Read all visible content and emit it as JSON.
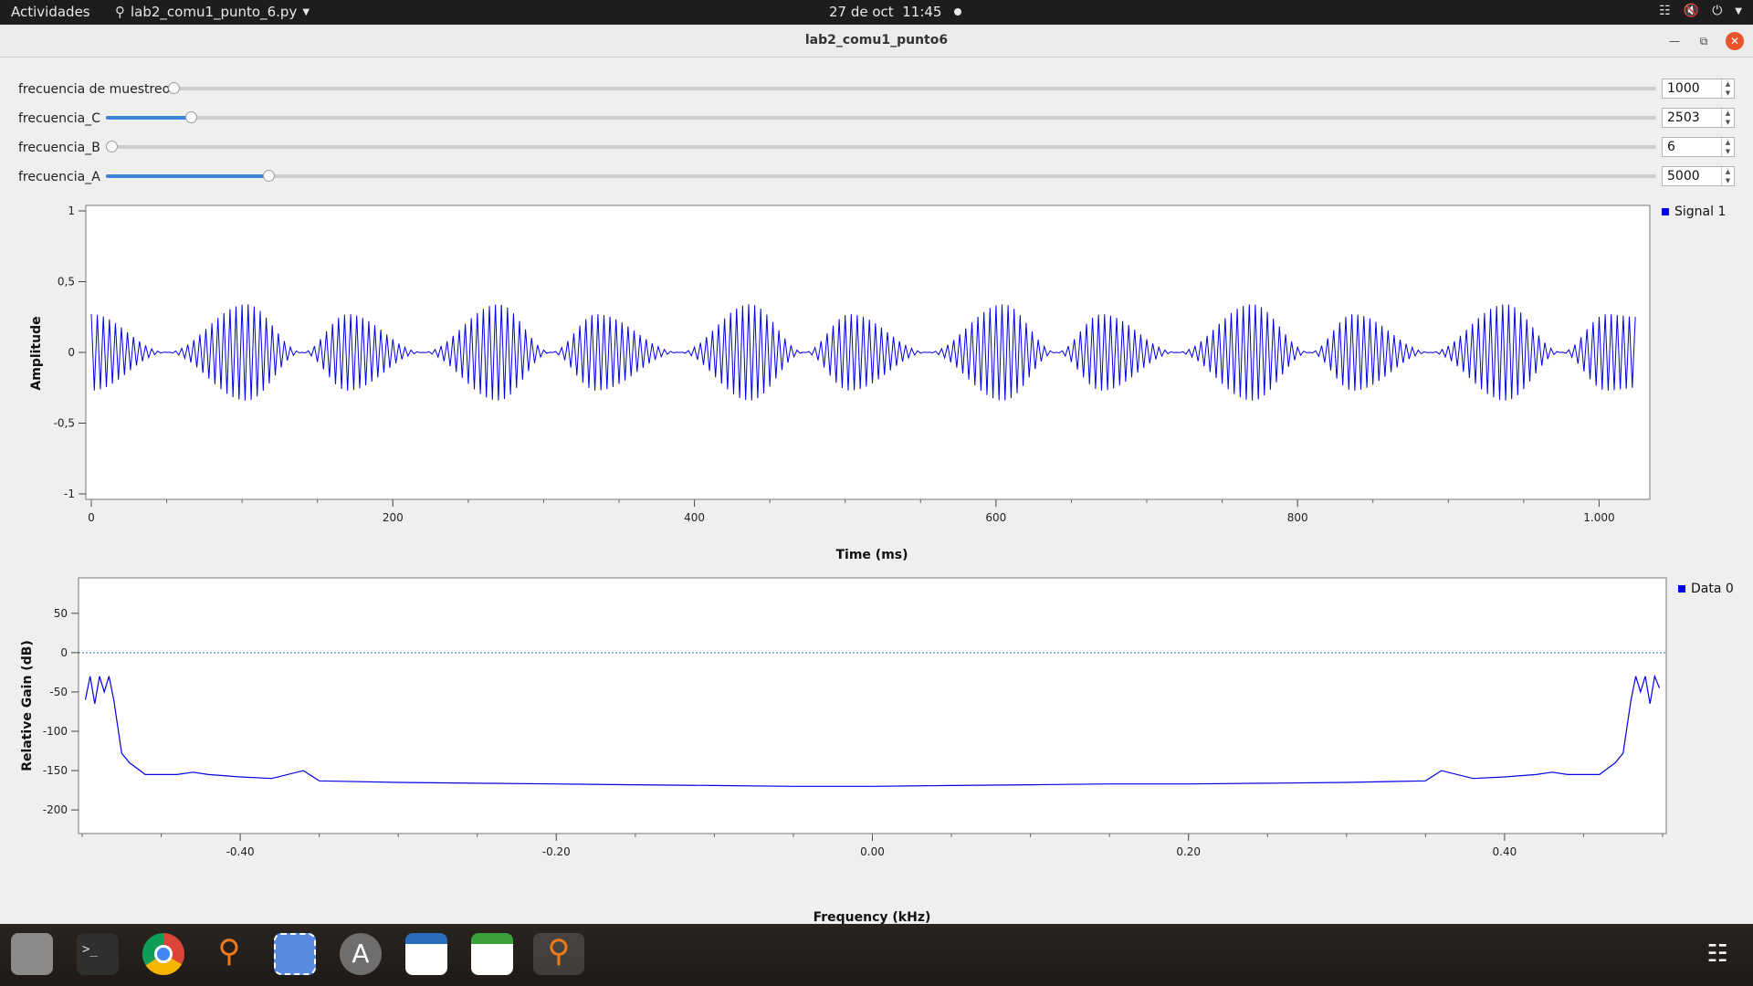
{
  "topbar": {
    "activities": "Actividades",
    "app_name": "lab2_comu1_punto_6.py",
    "date": "27 de oct",
    "time": "11:45"
  },
  "window": {
    "title": "lab2_comu1_punto6"
  },
  "sliders": [
    {
      "label": "frecuencia de muestreo",
      "value": "1000",
      "fraction": 0.0
    },
    {
      "label": "frecuencia_C",
      "value": "2503",
      "fraction": 0.055
    },
    {
      "label": "frecuencia_B",
      "value": "6",
      "fraction": 0.0
    },
    {
      "label": "frecuencia_A",
      "value": "5000",
      "fraction": 0.105
    }
  ],
  "time_plot": {
    "chart_data": {
      "type": "line",
      "xlabel": "Time (ms)",
      "ylabel": "Amplitude",
      "xlim": [
        0,
        1030
      ],
      "ylim": [
        -1,
        1
      ],
      "xticks": [
        "0",
        "200",
        "400",
        "600",
        "800",
        "1.000"
      ],
      "yticks": [
        "1",
        "0,5",
        "0",
        "-0,5",
        "-1"
      ],
      "legend": "Signal 1",
      "legend_placement": "top-right",
      "series": [
        {
          "name": "Signal 1",
          "description_free": true,
          "lobe_peaks": [
            {
              "x": 0,
              "amp": 0.27
            },
            {
              "x": 50,
              "amp": 0.0
            },
            {
              "x": 103,
              "amp": 0.34
            },
            {
              "x": 140,
              "amp": 0.0
            },
            {
              "x": 170,
              "amp": 0.27
            },
            {
              "x": 220,
              "amp": 0.0
            },
            {
              "x": 270,
              "amp": 0.34
            },
            {
              "x": 305,
              "amp": 0.0
            },
            {
              "x": 335,
              "amp": 0.27
            },
            {
              "x": 390,
              "amp": 0.0
            },
            {
              "x": 437,
              "amp": 0.34
            },
            {
              "x": 473,
              "amp": 0.0
            },
            {
              "x": 503,
              "amp": 0.27
            },
            {
              "x": 555,
              "amp": 0.0
            },
            {
              "x": 605,
              "amp": 0.34
            },
            {
              "x": 640,
              "amp": 0.0
            },
            {
              "x": 670,
              "amp": 0.27
            },
            {
              "x": 720,
              "amp": 0.0
            },
            {
              "x": 770,
              "amp": 0.34
            },
            {
              "x": 808,
              "amp": 0.0
            },
            {
              "x": 837,
              "amp": 0.27
            },
            {
              "x": 888,
              "amp": 0.0
            },
            {
              "x": 938,
              "amp": 0.34
            },
            {
              "x": 975,
              "amp": 0.0
            },
            {
              "x": 1005,
              "amp": 0.27
            },
            {
              "x": 1025,
              "amp": 0.25
            }
          ]
        }
      ]
    }
  },
  "freq_plot": {
    "chart_data": {
      "type": "line",
      "xlabel": "Frequency (kHz)",
      "ylabel": "Relative Gain (dB)",
      "xlim": [
        -0.5,
        0.5
      ],
      "ylim": [
        -230,
        95
      ],
      "xticks": [
        "-0.40",
        "-0.20",
        "0.00",
        "0.20",
        "0.40"
      ],
      "yticks": [
        "50",
        "0",
        "-50",
        "-100",
        "-150",
        "-200"
      ],
      "legend": "Data 0",
      "legend_placement": "top-right",
      "reference_line_db": 0,
      "series": [
        {
          "name": "Data 0",
          "x": [
            -0.498,
            -0.495,
            -0.492,
            -0.489,
            -0.486,
            -0.483,
            -0.48,
            -0.475,
            -0.47,
            -0.46,
            -0.45,
            -0.44,
            -0.43,
            -0.42,
            -0.4,
            -0.38,
            -0.36,
            -0.35,
            -0.3,
            -0.25,
            -0.2,
            -0.15,
            -0.1,
            -0.05,
            0.0,
            0.05,
            0.1,
            0.15,
            0.2,
            0.25,
            0.3,
            0.35,
            0.36,
            0.38,
            0.4,
            0.42,
            0.43,
            0.44,
            0.45,
            0.46,
            0.47,
            0.475,
            0.48,
            0.483,
            0.486,
            0.489,
            0.492,
            0.495,
            0.498
          ],
          "y": [
            -60,
            -30,
            -65,
            -30,
            -50,
            -30,
            -60,
            -128,
            -140,
            -155,
            -155,
            -155,
            -152,
            -155,
            -158,
            -160,
            -150,
            -163,
            -165,
            -166,
            -167,
            -168,
            -169,
            -170,
            -170,
            -169,
            -168,
            -167,
            -167,
            -166,
            -165,
            -163,
            -150,
            -160,
            -158,
            -155,
            -152,
            -155,
            -155,
            -155,
            -140,
            -128,
            -60,
            -30,
            -50,
            -30,
            -65,
            -30,
            -45
          ]
        }
      ]
    }
  },
  "dock": {
    "icons": [
      "files-icon",
      "terminal-icon",
      "chrome-icon",
      "gnuradio-icon",
      "screenshot-icon",
      "software-icon",
      "writer-icon",
      "calc-icon",
      "gnuradio-active-icon",
      "app-grid-icon"
    ]
  }
}
